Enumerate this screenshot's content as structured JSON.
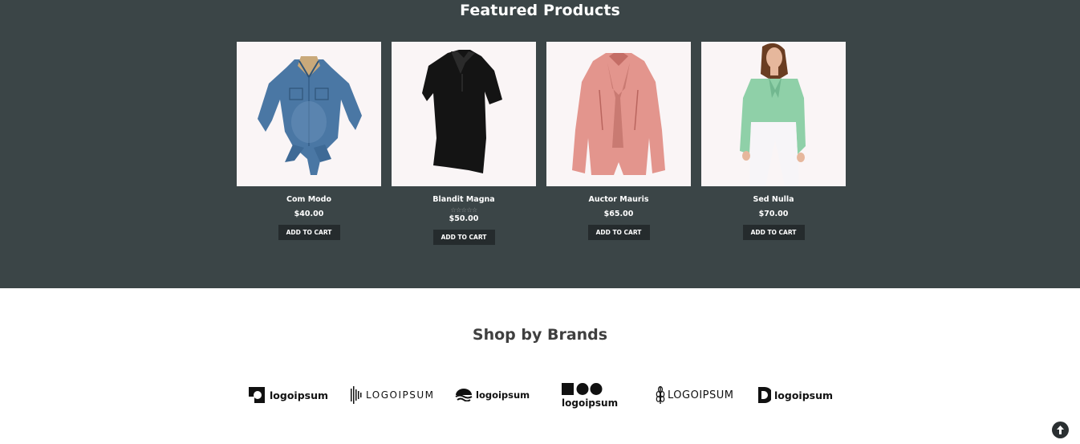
{
  "featured": {
    "title": "Featured Products",
    "background": "#3b4547",
    "add_to_cart_label": "ADD TO CART",
    "products": [
      {
        "name": "Com Modo",
        "price": "$40.00",
        "image": "denim-tie-front-shirt"
      },
      {
        "name": "Blandit Magna",
        "price": "$50.00",
        "image": "black-polo-shirt",
        "rating_stars": "☆☆☆☆☆"
      },
      {
        "name": "Auctor Mauris",
        "price": "$65.00",
        "image": "pink-leather-jacket"
      },
      {
        "name": "Sed Nulla",
        "price": "$70.00",
        "image": "mint-green-blouse-model"
      }
    ]
  },
  "brands": {
    "title": "Shop by Brands",
    "logos": [
      {
        "name": "logoipsum-1",
        "text": "logoipsum"
      },
      {
        "name": "logoipsum-2",
        "text": "LOGOIPSUM"
      },
      {
        "name": "logoipsum-3",
        "text": "logoipsum"
      },
      {
        "name": "logoipsum-4",
        "text": "logoipsum"
      },
      {
        "name": "logoipsum-5",
        "text": "LOGOIPSUM"
      },
      {
        "name": "logoipsum-6",
        "text": "logoipsum"
      }
    ]
  },
  "scroll_top_icon": "arrow-up-icon"
}
